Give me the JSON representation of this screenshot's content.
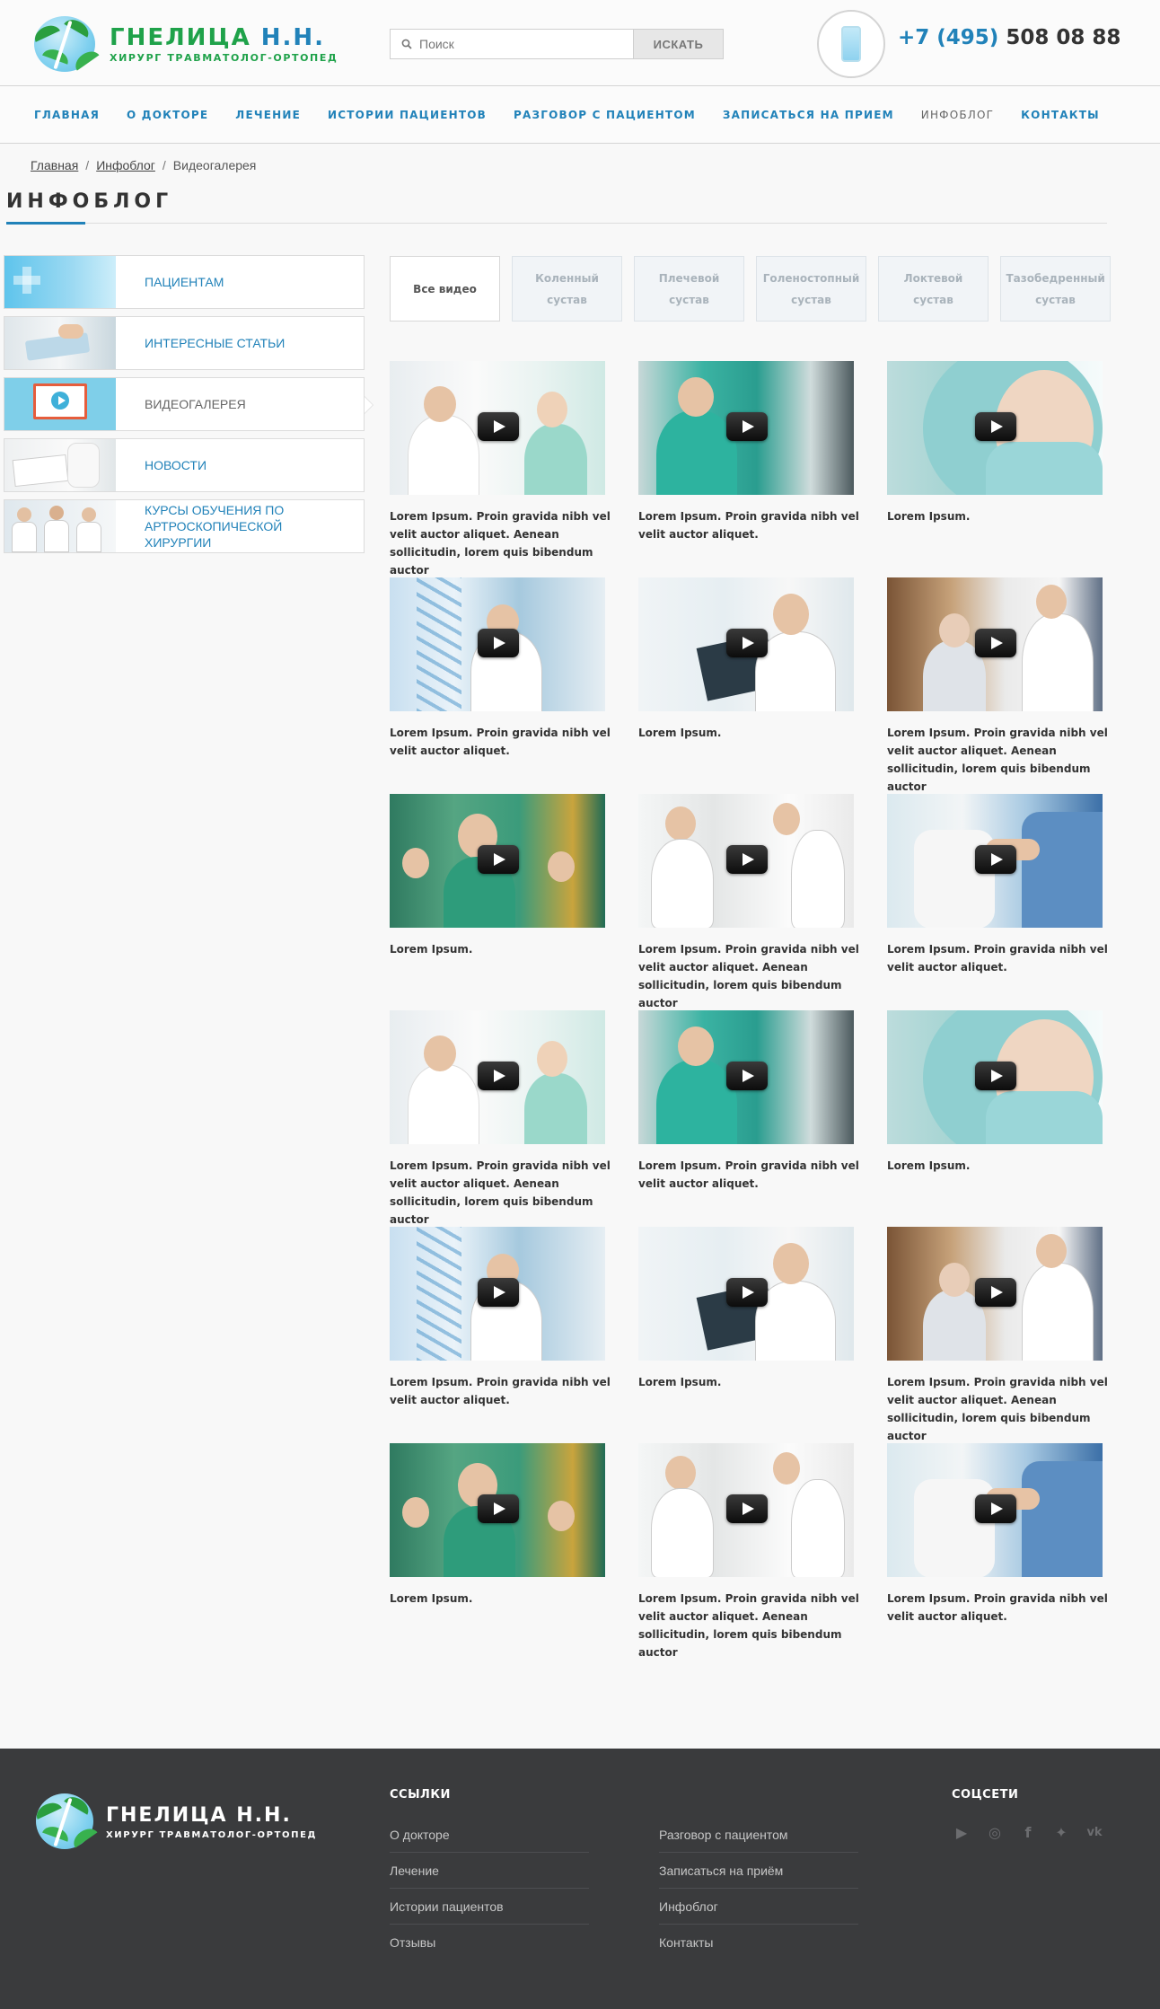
{
  "header": {
    "logo_name_part1": "ГНЕЛИЦА",
    "logo_name_part2": "Н.Н.",
    "logo_subtitle": "ХИРУРГ ТРАВМАТОЛОГ-ОРТОПЕД",
    "search_placeholder": "Поиск",
    "search_button": "ИСКАТЬ",
    "phone_code": "+7 (495)",
    "phone_number": "508 08 88"
  },
  "nav": {
    "items": [
      {
        "label": "ГЛАВНАЯ"
      },
      {
        "label": "О ДОКТОРЕ"
      },
      {
        "label": "ЛЕЧЕНИЕ"
      },
      {
        "label": "ИСТОРИИ ПАЦИЕНТОВ"
      },
      {
        "label": "РАЗГОВОР С ПАЦИЕНТОМ"
      },
      {
        "label": "ЗАПИСАТЬСЯ НА ПРИЕМ"
      },
      {
        "label": "ИНФОБЛОГ"
      },
      {
        "label": "КОНТАКТЫ"
      }
    ]
  },
  "breadcrumb": {
    "home": "Главная",
    "section": "Инфоблог",
    "current": "Видеогалерея",
    "separator": "/"
  },
  "page_title": "ИНФОБЛОГ",
  "sidebar": {
    "items": [
      {
        "label": "ПАЦИЕНТАМ"
      },
      {
        "label": "ИНТЕРЕСНЫЕ СТАТЬИ"
      },
      {
        "label": "ВИДЕОГАЛЕРЕЯ"
      },
      {
        "label": "НОВОСТИ"
      },
      {
        "label": "КУРСЫ ОБУЧЕНИЯ ПО АРТРОСКОПИЧЕСКОЙ ХИРУРГИИ"
      }
    ]
  },
  "filters": [
    {
      "label": "Все видео"
    },
    {
      "label": "Коленный сустав"
    },
    {
      "label": "Плечевой сустав"
    },
    {
      "label": "Голеностопный сустав"
    },
    {
      "label": "Локтевой сустав"
    },
    {
      "label": "Тазобедренный сустав"
    }
  ],
  "videos": [
    {
      "caption": "Lorem Ipsum. Proin gravida nibh vel velit auctor aliquet. Aenean sollicitudin, lorem quis bibendum auctor"
    },
    {
      "caption": "Lorem Ipsum. Proin gravida nibh vel velit auctor aliquet."
    },
    {
      "caption": "Lorem Ipsum."
    },
    {
      "caption": "Lorem Ipsum. Proin gravida nibh vel velit auctor aliquet."
    },
    {
      "caption": "Lorem Ipsum."
    },
    {
      "caption": "Lorem Ipsum. Proin gravida nibh vel velit auctor aliquet. Aenean sollicitudin, lorem quis bibendum auctor"
    },
    {
      "caption": "Lorem Ipsum."
    },
    {
      "caption": "Lorem Ipsum. Proin gravida nibh vel velit auctor aliquet. Aenean sollicitudin, lorem quis bibendum auctor"
    },
    {
      "caption": "Lorem Ipsum. Proin gravida nibh vel velit auctor aliquet."
    },
    {
      "caption": "Lorem Ipsum. Proin gravida nibh vel velit auctor aliquet. Aenean sollicitudin, lorem quis bibendum auctor"
    },
    {
      "caption": "Lorem Ipsum. Proin gravida nibh vel velit auctor aliquet."
    },
    {
      "caption": "Lorem Ipsum."
    },
    {
      "caption": "Lorem Ipsum. Proin gravida nibh vel velit auctor aliquet."
    },
    {
      "caption": "Lorem Ipsum."
    },
    {
      "caption": "Lorem Ipsum. Proin gravida nibh vel velit auctor aliquet. Aenean sollicitudin, lorem quis bibendum auctor"
    },
    {
      "caption": "Lorem Ipsum."
    },
    {
      "caption": "Lorem Ipsum. Proin gravida nibh vel velit auctor aliquet. Aenean sollicitudin, lorem quis bibendum auctor"
    },
    {
      "caption": "Lorem Ipsum. Proin gravida nibh vel velit auctor aliquet."
    }
  ],
  "footer": {
    "logo_name_part1": "ГНЕЛИЦА",
    "logo_name_part2": "Н.Н.",
    "logo_subtitle": "ХИРУРГ ТРАВМАТОЛОГ-ОРТОПЕД",
    "links_heading": "ССЫЛКИ",
    "links_col1": [
      {
        "label": "О докторе"
      },
      {
        "label": "Лечение"
      },
      {
        "label": "Истории пациентов"
      },
      {
        "label": "Отзывы"
      }
    ],
    "links_col2": [
      {
        "label": "Разговор с пациентом"
      },
      {
        "label": "Записаться на приём"
      },
      {
        "label": "Инфоблог"
      },
      {
        "label": "Контакты"
      }
    ],
    "social_heading": "СОЦСЕТИ",
    "socials": [
      {
        "icon": "youtube-icon",
        "glyph": "▶"
      },
      {
        "icon": "instagram-icon",
        "glyph": "◎"
      },
      {
        "icon": "facebook-icon",
        "glyph": "f"
      },
      {
        "icon": "twitter-icon",
        "glyph": "✦"
      },
      {
        "icon": "vk-icon",
        "glyph": "vk"
      }
    ]
  },
  "colors": {
    "brand_blue": "#2182b9",
    "brand_green": "#1fa24a",
    "footer_bg": "#3a3b3d",
    "page_bg": "#f8f8f8"
  }
}
